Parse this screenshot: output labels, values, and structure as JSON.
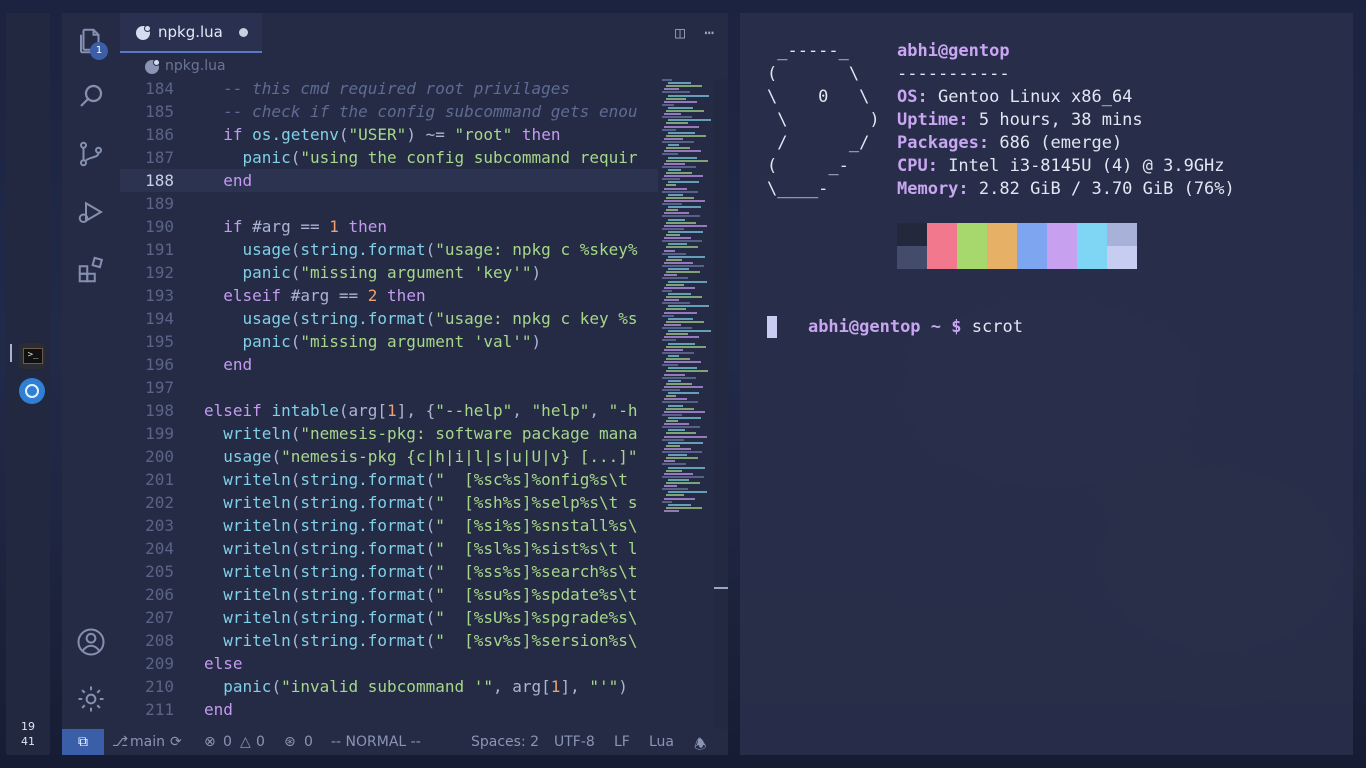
{
  "dock": {
    "clock_hour": "19",
    "clock_minute": "41"
  },
  "editor": {
    "source_control_badge": "1",
    "tab_filename": "npkg.lua",
    "breadcrumb_file": "npkg.lua",
    "current_line": "188",
    "lines": [
      {
        "no": "184",
        "html": "  <span class=\"c\">-- this cmd required root privilages</span>"
      },
      {
        "no": "185",
        "html": "  <span class=\"c\">-- check if the config subcommand gets enou</span>"
      },
      {
        "no": "186",
        "html": "  <span class=\"k\">if</span> <span class=\"f\">os.getenv</span>(<span class=\"s\">\"USER\"</span>) ~= <span class=\"s\">\"root\"</span> <span class=\"k\">then</span>"
      },
      {
        "no": "187",
        "html": "    <span class=\"f\">panic</span>(<span class=\"s\">\"using the config subcommand requir</span>"
      },
      {
        "no": "188",
        "html": "  <span class=\"k\">end</span>"
      },
      {
        "no": "189",
        "html": ""
      },
      {
        "no": "190",
        "html": "  <span class=\"k\">if</span> #arg == <span class=\"n\">1</span> <span class=\"k\">then</span>"
      },
      {
        "no": "191",
        "html": "    <span class=\"f\">usage</span>(<span class=\"f\">string.format</span>(<span class=\"s\">\"usage: npkg c %skey%</span>"
      },
      {
        "no": "192",
        "html": "    <span class=\"f\">panic</span>(<span class=\"s\">\"missing argument 'key'\"</span>)"
      },
      {
        "no": "193",
        "html": "  <span class=\"k\">elseif</span> #arg == <span class=\"n\">2</span> <span class=\"k\">then</span>"
      },
      {
        "no": "194",
        "html": "    <span class=\"f\">usage</span>(<span class=\"f\">string.format</span>(<span class=\"s\">\"usage: npkg c key %s</span>"
      },
      {
        "no": "195",
        "html": "    <span class=\"f\">panic</span>(<span class=\"s\">\"missing argument 'val'\"</span>)"
      },
      {
        "no": "196",
        "html": "  <span class=\"k\">end</span>"
      },
      {
        "no": "197",
        "html": ""
      },
      {
        "no": "198",
        "html": "<span class=\"k\">elseif</span> <span class=\"f\">intable</span>(arg[<span class=\"n\">1</span>], {<span class=\"s\">\"--help\"</span>, <span class=\"s\">\"help\"</span>, <span class=\"s\">\"-h</span>"
      },
      {
        "no": "199",
        "html": "  <span class=\"f\">writeln</span>(<span class=\"s\">\"nemesis-pkg: software package mana</span>"
      },
      {
        "no": "200",
        "html": "  <span class=\"f\">usage</span>(<span class=\"s\">\"nemesis-pkg {c|h|i|l|s|u|U|v} [...]\"</span>"
      },
      {
        "no": "201",
        "html": "  <span class=\"f\">writeln</span>(<span class=\"f\">string.format</span>(<span class=\"s\">\"  [%sc%s]%onfig%s\\t </span>"
      },
      {
        "no": "202",
        "html": "  <span class=\"f\">writeln</span>(<span class=\"f\">string.format</span>(<span class=\"s\">\"  [%sh%s]%selp%s\\t s</span>"
      },
      {
        "no": "203",
        "html": "  <span class=\"f\">writeln</span>(<span class=\"f\">string.format</span>(<span class=\"s\">\"  [%si%s]%snstall%s\\</span>"
      },
      {
        "no": "204",
        "html": "  <span class=\"f\">writeln</span>(<span class=\"f\">string.format</span>(<span class=\"s\">\"  [%sl%s]%sist%s\\t l</span>"
      },
      {
        "no": "205",
        "html": "  <span class=\"f\">writeln</span>(<span class=\"f\">string.format</span>(<span class=\"s\">\"  [%ss%s]%search%s\\t</span>"
      },
      {
        "no": "206",
        "html": "  <span class=\"f\">writeln</span>(<span class=\"f\">string.format</span>(<span class=\"s\">\"  [%su%s]%spdate%s\\t</span>"
      },
      {
        "no": "207",
        "html": "  <span class=\"f\">writeln</span>(<span class=\"f\">string.format</span>(<span class=\"s\">\"  [%sU%s]%spgrade%s\\</span>"
      },
      {
        "no": "208",
        "html": "  <span class=\"f\">writeln</span>(<span class=\"f\">string.format</span>(<span class=\"s\">\"  [%sv%s]%sersion%s\\</span>"
      },
      {
        "no": "209",
        "html": "<span class=\"k\">else</span>"
      },
      {
        "no": "210",
        "html": "  <span class=\"f\">panic</span>(<span class=\"s\">\"invalid subcommand '\"</span>, arg[<span class=\"n\">1</span>], <span class=\"s\">\"'\"</span>)"
      },
      {
        "no": "211",
        "html": "<span class=\"k\">end</span>"
      }
    ],
    "status": {
      "branch": "main",
      "errors": "0",
      "warnings": "0",
      "ports": "0",
      "mode": "-- NORMAL --",
      "spaces": "Spaces: 2",
      "encoding": "UTF-8",
      "eol": "LF",
      "language": "Lua"
    }
  },
  "terminal": {
    "logo": [
      " _-----_",
      "(       \\",
      "\\    0   \\",
      " \\        )",
      " /      _/",
      "(     _-",
      "\\____-"
    ],
    "user_host": "abhi@gentop",
    "separator": "-----------",
    "info": [
      {
        "label": "OS",
        "value": " Gentoo Linux x86_64"
      },
      {
        "label": "Uptime",
        "value": " 5 hours, 38 mins"
      },
      {
        "label": "Packages",
        "value": " 686 (emerge)"
      },
      {
        "label": "CPU",
        "value": " Intel i3-8145U (4) @ 3.9GHz"
      },
      {
        "label": "Memory",
        "value": " 2.82 GiB / 3.70 GiB (76%)"
      }
    ],
    "palette_top": [
      "#23283d",
      "#f2788e",
      "#a6d86e",
      "#e6b166",
      "#7ea6f0",
      "#c7a0f0",
      "#7fd6f4",
      "#a8b2d8"
    ],
    "palette_bottom": [
      "#444c6c",
      "#f2788e",
      "#a6d86e",
      "#e6b166",
      "#7ea6f0",
      "#c7a0f0",
      "#7fd6f4",
      "#c6cdf0"
    ],
    "prompt_user": "abhi@gentop",
    "prompt_dir": " ~ ",
    "prompt_symbol": "$",
    "command": " scrot"
  }
}
